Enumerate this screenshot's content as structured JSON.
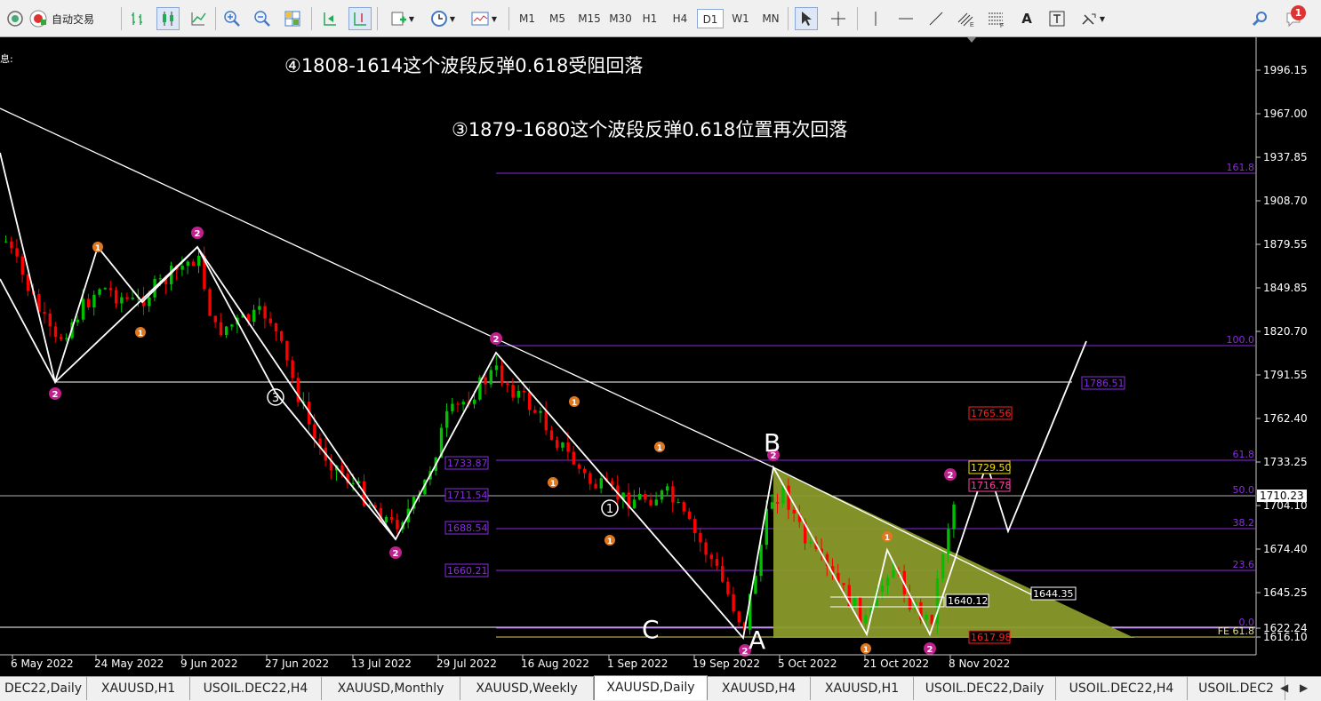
{
  "toolbar": {
    "auto_trading_label": "自动交易",
    "timeframes": [
      "M1",
      "M5",
      "M15",
      "M30",
      "H1",
      "H4",
      "D1",
      "W1",
      "MN"
    ],
    "active_timeframe": "D1",
    "font_tool_label": "A",
    "notification_count": "1"
  },
  "chart": {
    "info_label": "息:",
    "annotation_1": "④1808-1614这个波段反弹0.618受阻回落",
    "annotation_2": "③1879-1680这个波段反弹0.618位置再次回落",
    "current_price": "1710.23",
    "price_axis": [
      "1996.15",
      "1967.00",
      "1937.85",
      "1908.70",
      "1879.55",
      "1849.85",
      "1820.70",
      "1791.55",
      "1762.40",
      "1733.25",
      "1704.10",
      "1674.40",
      "1645.25",
      "1622.24",
      "1616.10"
    ],
    "date_axis": [
      "6 May 2022",
      "24 May 2022",
      "9 Jun 2022",
      "27 Jun 2022",
      "13 Jul 2022",
      "29 Jul 2022",
      "16 Aug 2022",
      "1 Sep 2022",
      "19 Sep 2022",
      "5 Oct 2022",
      "21 Oct 2022",
      "8 Nov 2022"
    ],
    "fib_labels": [
      "161.8",
      "100.0",
      "61.8",
      "50.0",
      "38.2",
      "23.6",
      "0.0",
      "FE 61.8"
    ],
    "price_boxes": [
      "1733.87",
      "1711.54",
      "1688.54",
      "1660.21",
      "1786.51",
      "1765.56",
      "1729.50",
      "1716.78",
      "1640.12",
      "1644.35",
      "1617.98"
    ],
    "point_labels": [
      "A",
      "B",
      "C"
    ],
    "colors": {
      "bull": "#00c000",
      "bear": "#ff0000",
      "fib": "#8a2be2",
      "triangle": "#8a9a2a",
      "wave_magenta": "#c0208c",
      "wave_orange": "#e07820"
    }
  },
  "tabs": [
    "DEC22,Daily",
    "XAUUSD,H1",
    "USOIL.DEC22,H4",
    "XAUUSD,Monthly",
    "XAUUSD,Weekly",
    "XAUUSD,Daily",
    "XAUUSD,H4",
    "XAUUSD,H1",
    "USOIL.DEC22,Daily",
    "USOIL.DEC22,H4",
    "USOIL.DEC2"
  ],
  "active_tab": "XAUUSD,Daily"
}
